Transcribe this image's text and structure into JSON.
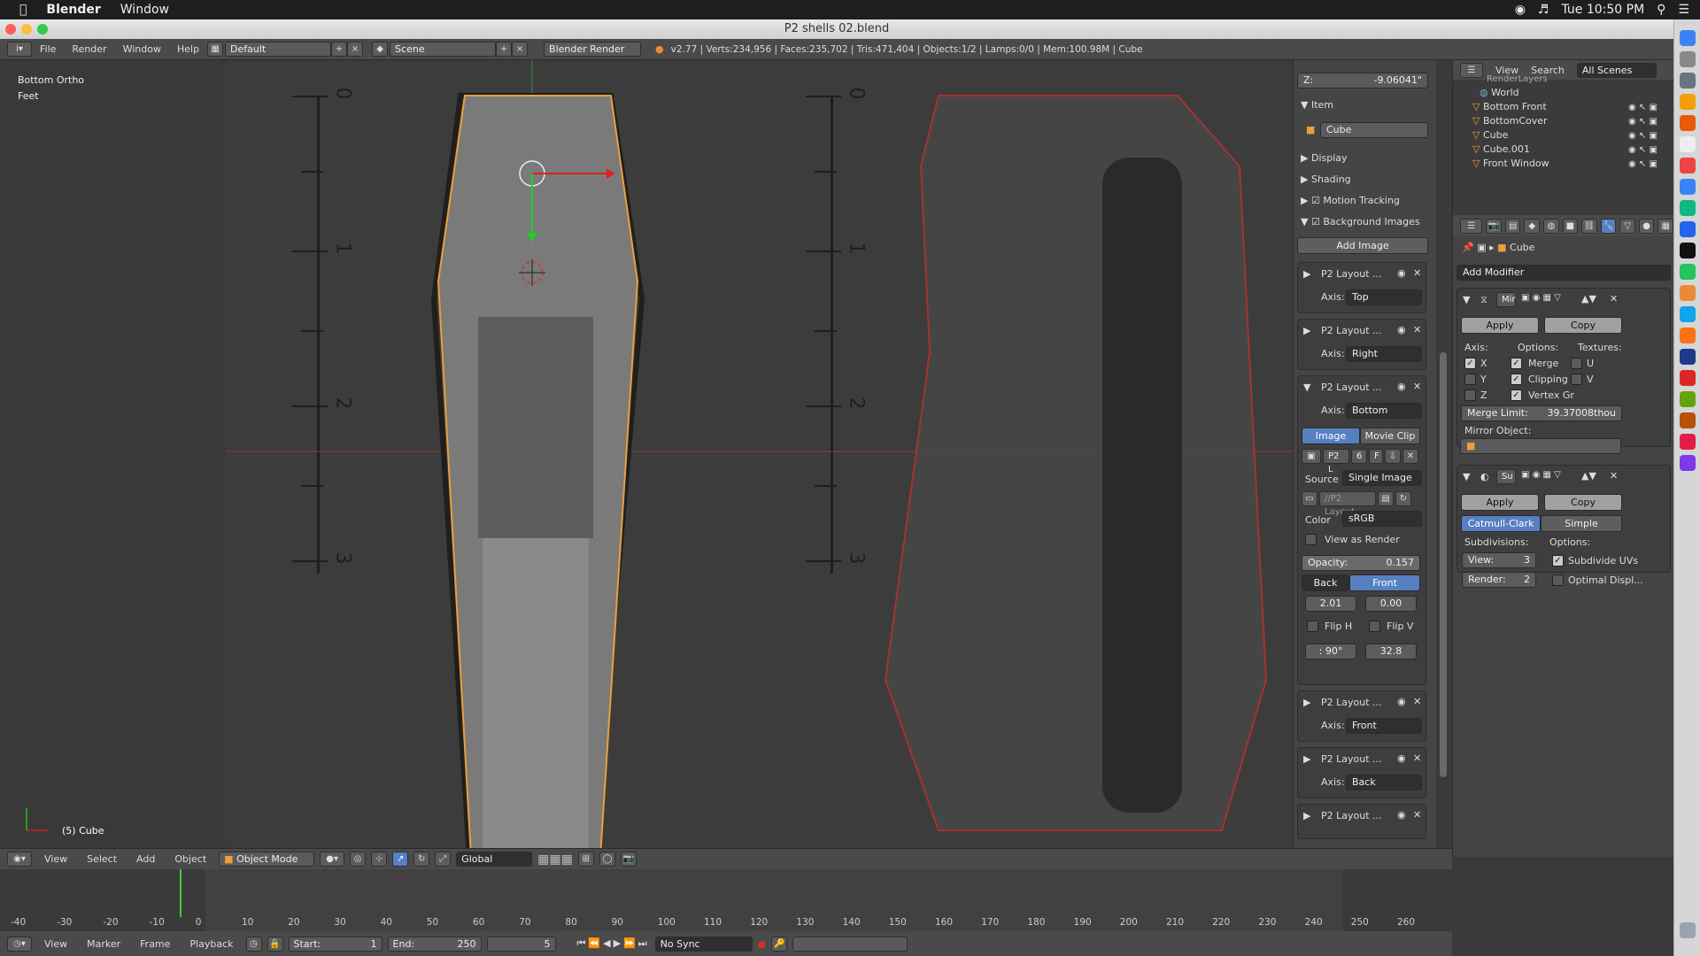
{
  "macbar": {
    "apple_icon": "apple-icon",
    "app": "Blender",
    "menu": "Window",
    "clock": "Tue 10:50 PM"
  },
  "window": {
    "title": "P2 shells 02.blend"
  },
  "topheader": {
    "menus": [
      "File",
      "Render",
      "Window",
      "Help"
    ],
    "layout": "Default",
    "scene": "Scene",
    "engine": "Blender Render",
    "stats": "v2.77 | Verts:234,956 | Faces:235,702 | Tris:471,404 | Objects:1/2 | Lamps:0/0 | Mem:100.98M | Cube"
  },
  "viewport": {
    "view_name": "Bottom Ortho",
    "units": "Feet",
    "active_object": "(5) Cube",
    "ruler_left_labels": [
      "0",
      "1",
      "2",
      "3"
    ],
    "ruler_right_labels": [
      "0",
      "1",
      "2",
      "3"
    ]
  },
  "npanel": {
    "z_label": "Z:",
    "z_value": "-9.06041\"",
    "item_header": "Item",
    "object_name": "Cube",
    "display": "Display",
    "shading": "Shading",
    "motion_tracking": "Motion Tracking",
    "background_images": "Background Images",
    "add_image": "Add Image",
    "bg_items": [
      {
        "name": "P2 Layout ...",
        "axis_label": "Axis:",
        "axis": "Top"
      },
      {
        "name": "P2 Layout ...",
        "axis_label": "Axis:",
        "axis": "Right"
      },
      {
        "name": "P2 Layout ...",
        "axis_label": "Axis:",
        "axis": "Bottom"
      }
    ],
    "tab_image": "Image",
    "tab_movie": "Movie Clip",
    "img_name": "P2 L",
    "img_users": "6",
    "img_f": "F",
    "source_label": "Source",
    "source": "Single Image",
    "path": "//P2 Layout...",
    "color_label": "Color",
    "color": "sRGB",
    "view_as_render": "View as Render",
    "opacity_label": "Opacity:",
    "opacity": "0.157",
    "back": "Back",
    "front": "Front",
    "x_offset": "2.01",
    "y_offset": "0.00",
    "flip_h": "Flip H",
    "flip_v": "Flip V",
    "rotation": ": 90°",
    "size": "32.8",
    "bg_items2": [
      {
        "name": "P2 Layout ...",
        "axis_label": "Axis:",
        "axis": "Front"
      },
      {
        "name": "P2 Layout ...",
        "axis_label": "Axis:",
        "axis": "Back"
      },
      {
        "name": "P2 Layout ..."
      }
    ]
  },
  "outliner": {
    "menu_view": "View",
    "menu_search": "Search",
    "scenes": "All Scenes",
    "items": [
      "RenderLayers",
      "World",
      "Bottom Front",
      "BottomCover",
      "Cube",
      "Cube.001",
      "Front Window"
    ]
  },
  "properties": {
    "context_object": "Cube",
    "add_modifier": "Add Modifier",
    "mirror": {
      "name": "Mir",
      "apply": "Apply",
      "copy": "Copy",
      "axis_label": "Axis:",
      "options_label": "Options:",
      "textures_label": "Textures:",
      "x": "X",
      "y": "Y",
      "z": "Z",
      "merge": "Merge",
      "clipping": "Clipping",
      "vertex_gr": "Vertex Gr",
      "u": "U",
      "v": "V",
      "merge_limit_label": "Merge Limit:",
      "merge_limit": "39.37008thou",
      "mirror_object": "Mirror Object:"
    },
    "subsurf": {
      "name": "Su",
      "apply": "Apply",
      "copy": "Copy",
      "catmull": "Catmull-Clark",
      "simple": "Simple",
      "subdivisions": "Subdivisions:",
      "options": "Options:",
      "view_label": "View:",
      "view": "3",
      "render_label": "Render:",
      "render": "2",
      "subdivide_uvs": "Subdivide UVs",
      "optimal": "Optimal Displ..."
    }
  },
  "viewheader": {
    "menus": [
      "View",
      "Select",
      "Add",
      "Object"
    ],
    "mode": "Object Mode",
    "orientation": "Global"
  },
  "timeline": {
    "ticks": [
      "-40",
      "-30",
      "-20",
      "-10",
      "0",
      "10",
      "20",
      "30",
      "40",
      "50",
      "60",
      "70",
      "80",
      "90",
      "100",
      "110",
      "120",
      "130",
      "140",
      "150",
      "160",
      "170",
      "180",
      "190",
      "200",
      "210",
      "220",
      "230",
      "240",
      "250",
      "260"
    ],
    "current_frame": "5"
  },
  "tlheader": {
    "menus": [
      "View",
      "Marker",
      "Frame",
      "Playback"
    ],
    "start_label": "Start:",
    "start": "1",
    "end_label": "End:",
    "end": "250",
    "frame": "5",
    "sync": "No Sync"
  }
}
